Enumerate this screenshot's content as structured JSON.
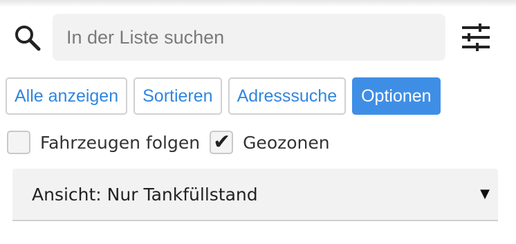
{
  "search": {
    "placeholder": "In der Liste suchen",
    "value": "",
    "icon": "search-icon",
    "filter_icon": "sliders-icon"
  },
  "buttons": [
    {
      "label": "Alle anzeigen",
      "active": false
    },
    {
      "label": "Sortieren",
      "active": false
    },
    {
      "label": "Adresssuche",
      "active": false
    },
    {
      "label": "Optionen",
      "active": true
    }
  ],
  "options": {
    "follow_vehicles": {
      "label": "Fahrzeugen folgen",
      "checked": false
    },
    "geozones": {
      "label": "Geozonen",
      "checked": true
    }
  },
  "view_select": {
    "selected": "Ansicht: Nur Tankfüllstand",
    "arrow": "▼"
  },
  "colors": {
    "accent": "#3f8ee6",
    "link": "#2f86df",
    "field_bg": "#f2f2f2"
  }
}
